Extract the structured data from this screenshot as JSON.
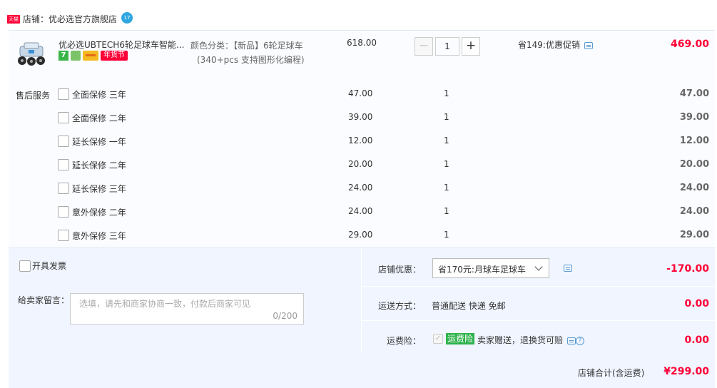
{
  "shop": {
    "badge": "天猫",
    "name": "店铺：优必选官方旗舰店",
    "chat_badge": "17"
  },
  "product": {
    "title": "优必选UBTECH6轮足球车智能...",
    "sku_line1": "颜色分类：【新品】6轮足球车",
    "sku_line2": "(340+pcs 支持图形化编程)",
    "price": "618.00",
    "quantity": "1",
    "promo": "省149:优惠促销",
    "total": "469.00",
    "badge_7": "7",
    "badge_newyear": "年货节"
  },
  "services": {
    "label": "售后服务",
    "items": [
      {
        "name": "全面保修 三年",
        "price": "47.00",
        "qty": "1",
        "total": "47.00"
      },
      {
        "name": "全面保修 二年",
        "price": "39.00",
        "qty": "1",
        "total": "39.00"
      },
      {
        "name": "延长保修 一年",
        "price": "12.00",
        "qty": "1",
        "total": "12.00"
      },
      {
        "name": "延长保修 二年",
        "price": "20.00",
        "qty": "1",
        "total": "20.00"
      },
      {
        "name": "延长保修 三年",
        "price": "24.00",
        "qty": "1",
        "total": "24.00"
      },
      {
        "name": "意外保修 二年",
        "price": "24.00",
        "qty": "1",
        "total": "24.00"
      },
      {
        "name": "意外保修 三年",
        "price": "29.00",
        "qty": "1",
        "total": "29.00"
      }
    ]
  },
  "invoice": {
    "label": "开具发票"
  },
  "message": {
    "label": "给卖家留言：",
    "placeholder": "选填，请先和商家协商一致，付款后商家可见",
    "count": "0/200"
  },
  "discount": {
    "label": "店铺优惠：",
    "selected": "省170元:月球车足球车",
    "value": "-170.00"
  },
  "shipping": {
    "label": "运送方式：",
    "text": "普通配送 快递 免邮",
    "value": "0.00"
  },
  "insurance": {
    "label": "运费险：",
    "badge": "运费险",
    "text": "卖家赠送，退换货可赔",
    "value": "0.00"
  },
  "summary": {
    "label": "店铺合计(含运费)",
    "value": "¥299.00"
  },
  "colors": {
    "accent": "#ff0036",
    "bg_light": "#f0f5ff",
    "link": "#5a9bd5",
    "green": "#2db24a"
  }
}
